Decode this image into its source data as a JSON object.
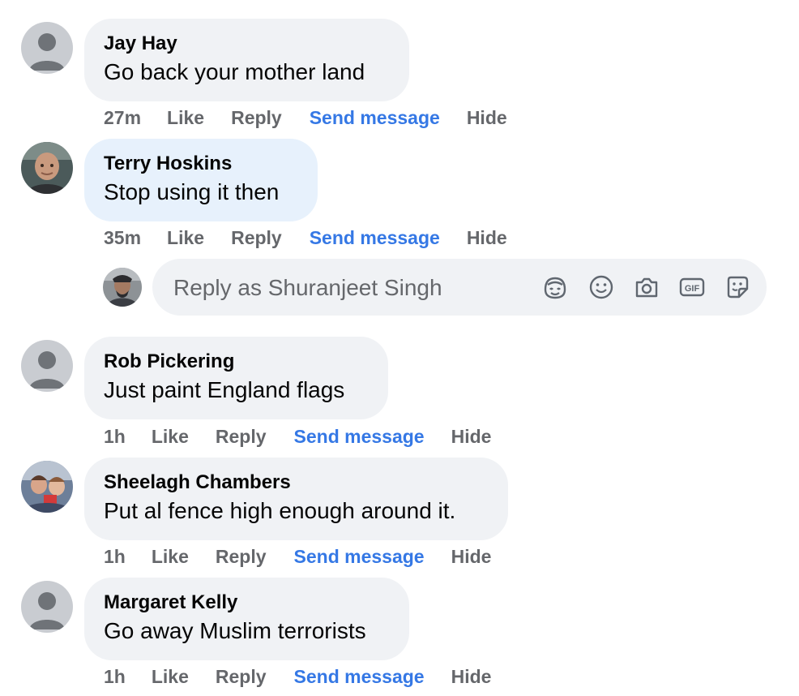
{
  "comments": [
    {
      "author": "Jay Hay",
      "text": "Go back your mother land",
      "time": "27m",
      "like": "Like",
      "reply": "Reply",
      "send": "Send message",
      "hide": "Hide",
      "avatar": "default-avatar"
    },
    {
      "author": "Terry Hoskins",
      "text": "Stop using it then",
      "time": "35m",
      "like": "Like",
      "reply": "Reply",
      "send": "Send message",
      "hide": "Hide",
      "avatar": "profile-photo"
    },
    {
      "author": "Rob Pickering",
      "text": "Just paint England flags",
      "time": "1h",
      "like": "Like",
      "reply": "Reply",
      "send": "Send message",
      "hide": "Hide",
      "avatar": "default-avatar"
    },
    {
      "author": "Sheelagh Chambers",
      "text": "Put al fence high enough around it.",
      "time": "1h",
      "like": "Like",
      "reply": "Reply",
      "send": "Send message",
      "hide": "Hide",
      "avatar": "profile-photo"
    },
    {
      "author": "Margaret Kelly",
      "text": "Go away Muslim terrorists",
      "time": "1h",
      "like": "Like",
      "reply": "Reply",
      "send": "Send message",
      "hide": "Hide",
      "avatar": "default-avatar"
    }
  ],
  "reply_box": {
    "placeholder": "Reply as Shuranjeet Singh",
    "gif_label": "GIF",
    "icons": [
      "avatar-sticker-icon",
      "emoji-icon",
      "camera-icon",
      "gif-icon",
      "sticker-icon"
    ]
  },
  "colors": {
    "bubble": "#f0f2f5",
    "bubble_highlight": "#e7f1fc",
    "action_grey": "#65676b",
    "link_blue": "#3578e5"
  }
}
